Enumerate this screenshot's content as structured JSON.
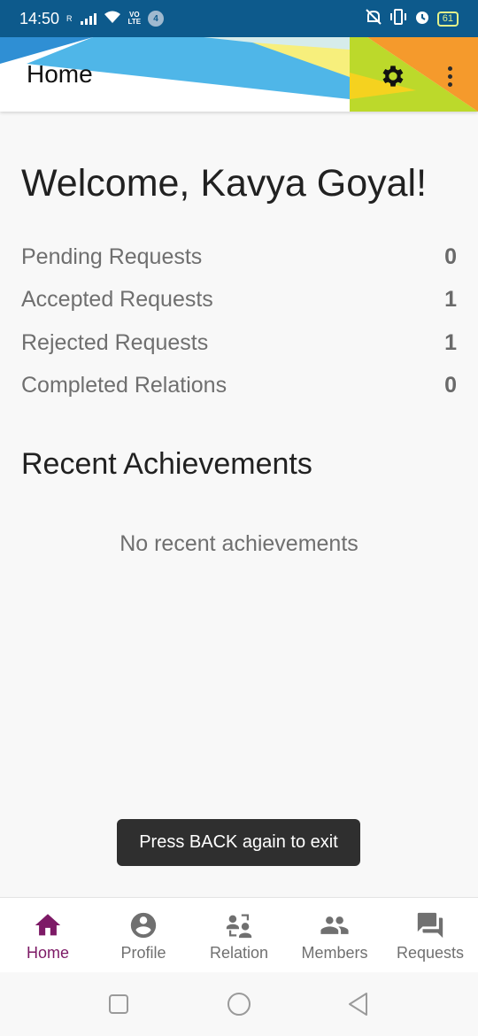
{
  "status_bar": {
    "time": "14:50",
    "carrier_small": "R",
    "volte_line1": "VO",
    "volte_line2": "LTE",
    "notification_count": "4",
    "battery": "61"
  },
  "app_bar": {
    "title": "Home",
    "icons": [
      "gear-icon",
      "more-vertical-icon"
    ]
  },
  "main": {
    "welcome": "Welcome, Kavya Goyal!",
    "stats": [
      {
        "label": "Pending Requests",
        "value": "0"
      },
      {
        "label": "Accepted Requests",
        "value": "1"
      },
      {
        "label": "Rejected Requests",
        "value": "1"
      },
      {
        "label": "Completed Relations",
        "value": "0"
      }
    ],
    "achievements_title": "Recent Achievements",
    "achievements_empty": "No recent achievements"
  },
  "toast": {
    "message": "Press BACK again to exit"
  },
  "bottom_nav": {
    "items": [
      {
        "label": "Home",
        "icon": "home-icon",
        "active": true
      },
      {
        "label": "Profile",
        "icon": "account-circle-icon",
        "active": false
      },
      {
        "label": "Relation",
        "icon": "relation-swap-icon",
        "active": false
      },
      {
        "label": "Members",
        "icon": "group-icon",
        "active": false
      },
      {
        "label": "Requests",
        "icon": "forum-icon",
        "active": false
      }
    ]
  },
  "colors": {
    "accent": "#7d1a66",
    "status_bar": "#0d5a8c",
    "toast_bg": "#2f2f2f"
  }
}
